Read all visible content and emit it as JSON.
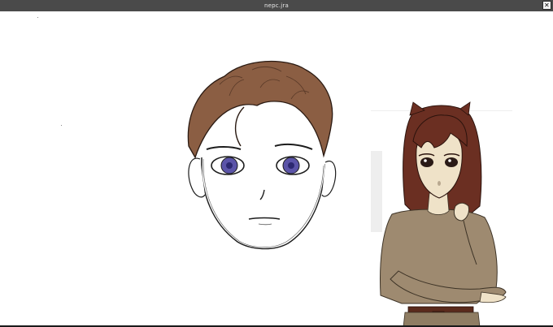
{
  "window": {
    "title": "nepc.jra",
    "close_label": "✕"
  },
  "colors": {
    "titlebar": "#4a4a4a",
    "hair_brown": "#8b5e43",
    "eye_purple": "#5b54a8",
    "girl_hair": "#6b2f22",
    "tunic": "#9e8a70",
    "skin": "#efe2c8"
  }
}
